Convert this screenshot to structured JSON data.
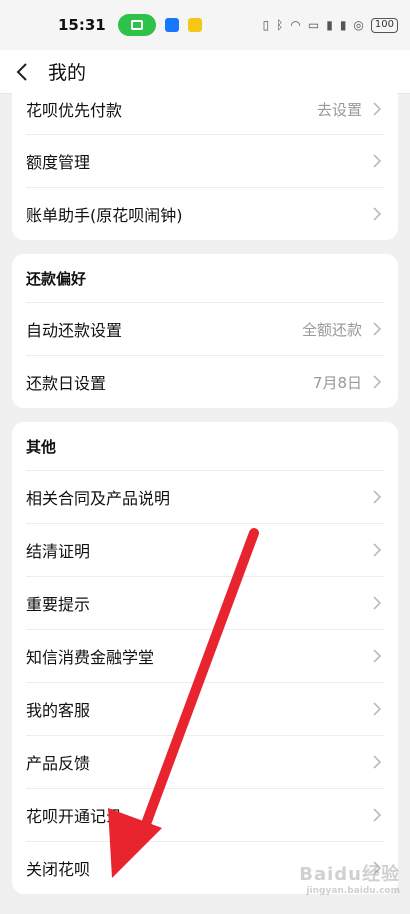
{
  "status_bar": {
    "time": "15:31",
    "battery": "100",
    "icons": [
      "cast-icon",
      "app-notification-icon",
      "vibrate-icon",
      "bluetooth-icon",
      "wifi-icon",
      "hd-icon",
      "signal-icon",
      "signal-icon",
      "vpn-icon",
      "battery-icon"
    ]
  },
  "nav": {
    "title": "我的",
    "back_icon": "chevron-left-icon"
  },
  "card1": {
    "rows": [
      {
        "label": "花呗优先付款",
        "value": "去设置"
      },
      {
        "label": "额度管理",
        "value": ""
      },
      {
        "label": "账单助手(原花呗闹钟)",
        "value": ""
      }
    ]
  },
  "card2": {
    "header": "还款偏好",
    "rows": [
      {
        "label": "自动还款设置",
        "value": "全额还款"
      },
      {
        "label": "还款日设置",
        "value": "7月8日"
      }
    ]
  },
  "card3": {
    "header": "其他",
    "rows": [
      {
        "label": "相关合同及产品说明",
        "value": ""
      },
      {
        "label": "结清证明",
        "value": ""
      },
      {
        "label": "重要提示",
        "value": ""
      },
      {
        "label": "知信消费金融学堂",
        "value": ""
      },
      {
        "label": "我的客服",
        "value": ""
      },
      {
        "label": "产品反馈",
        "value": ""
      },
      {
        "label": "花呗开通记录",
        "value": ""
      },
      {
        "label": "关闭花呗",
        "value": ""
      }
    ]
  },
  "watermark": {
    "text": "Baidu经验",
    "sub": "jingyan.baidu.com"
  },
  "colors": {
    "accent_arrow": "#e8242f",
    "cast_green": "#2ec24a",
    "background": "#f0f0f0"
  }
}
